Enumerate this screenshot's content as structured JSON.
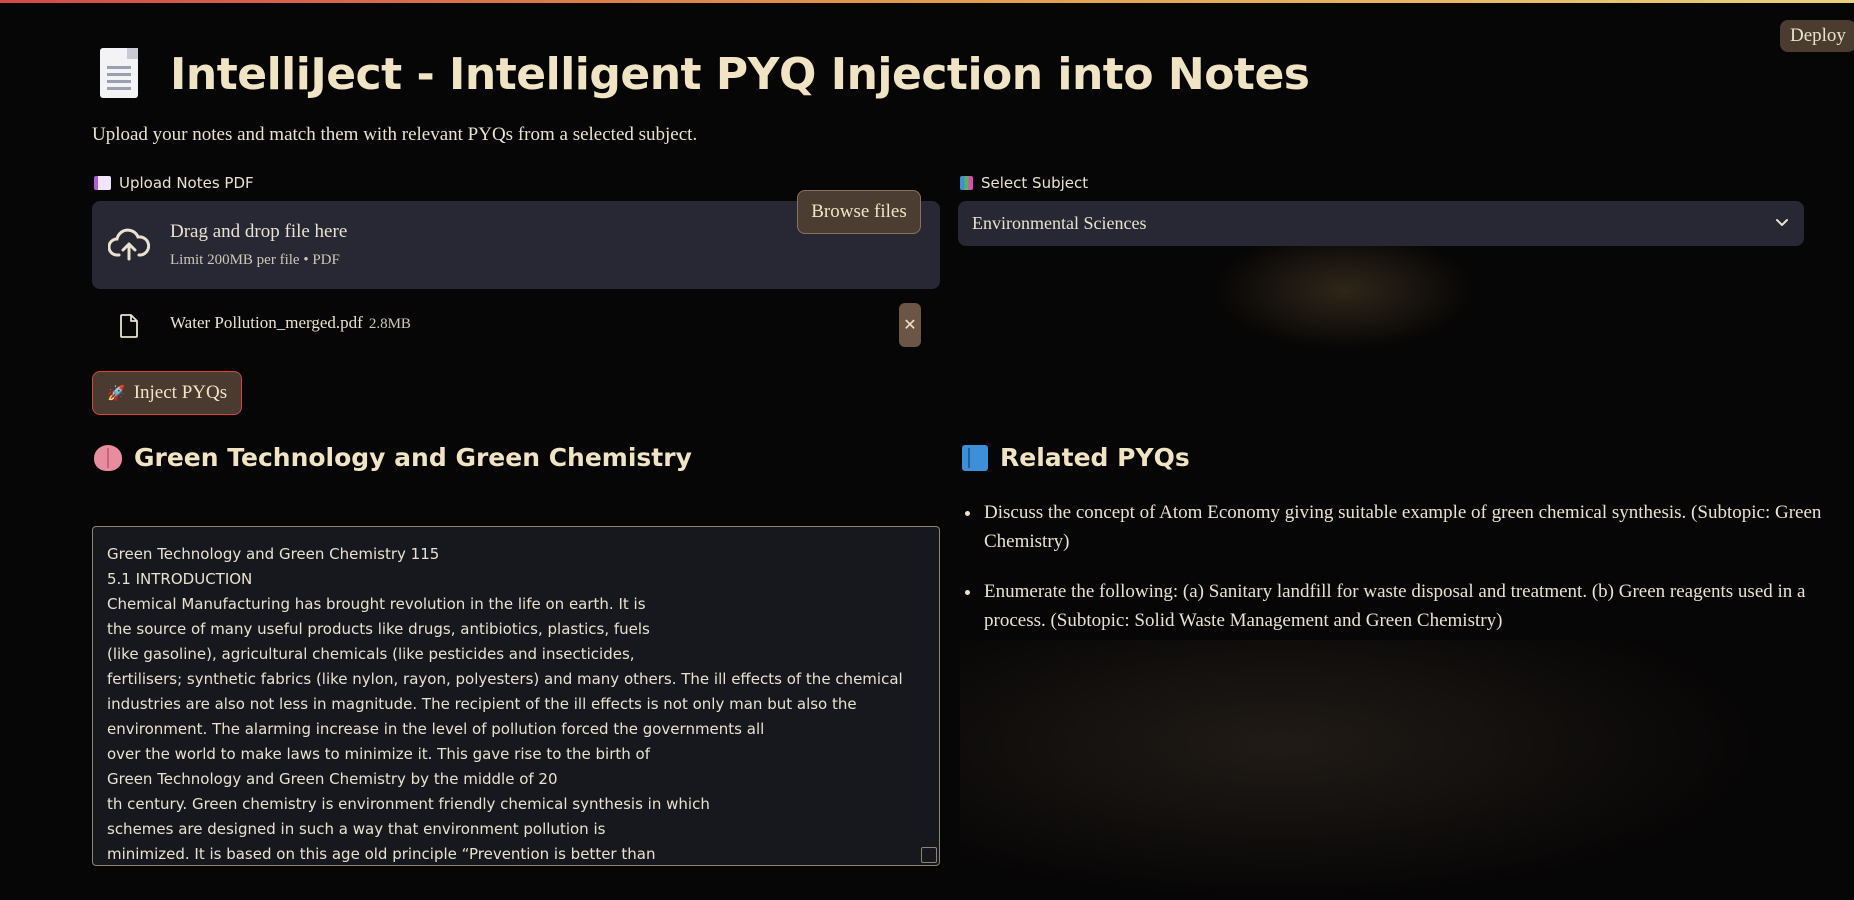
{
  "toolbar": {
    "deploy_label": "Deploy"
  },
  "header": {
    "title": "IntelliJect - Intelligent PYQ Injection into Notes",
    "subtitle": "Upload your notes and match them with relevant PYQs from a selected subject."
  },
  "upload": {
    "label": "Upload Notes PDF",
    "drag_text": "Drag and drop file here",
    "limit_text": "Limit 200MB per file • PDF",
    "browse_label": "Browse files",
    "file_name": "Water Pollution_merged.pdf",
    "file_size": "2.8MB"
  },
  "subject": {
    "label": "Select Subject",
    "selected": "Environmental Sciences"
  },
  "inject_button": "Inject PYQs",
  "notes": {
    "heading": "Green Technology and Green Chemistry",
    "lines": [
      "Green Technology and Green Chemistry 115",
      "5.1 INTRODUCTION",
      "Chemical Manufacturing has brought revolution in the life on earth. It is",
      "the source of many useful products like drugs, antibiotics, plastics, fuels",
      "(like gasoline), agricultural chemicals (like pesticides and insecticides,",
      "fertilisers; synthetic fabrics (like nylon, rayon, polyesters) and many others. The ill effects of the chemical",
      "industries are also not less in magnitude. The recipient of the ill effects is not only man but also the",
      "environment. The alarming increase in the level of pollution forced the governments all",
      "over the world to make laws to minimize it. This gave rise to the birth of",
      "Green Technology and Green Chemistry by the middle of 20",
      "th century. Green chemistry is environment friendly chemical synthesis in which",
      "schemes are designed in such a way that environment pollution is",
      "minimized. It is based on this age old principle “Prevention is better than"
    ]
  },
  "pyqs": {
    "heading": "Related PYQs",
    "items": [
      "Discuss the concept of Atom Economy giving suitable example of green chemical synthesis. (Subtopic: Green Chemistry)",
      "Enumerate the following: (a) Sanitary landfill for waste disposal and treatment. (b) Green reagents used in a process. (Subtopic: Solid Waste Management and Green Chemistry)"
    ]
  },
  "colors": {
    "accent": "#d4463e",
    "title": "#f1e4c4",
    "panel": "#272833"
  },
  "icons": [
    "document-icon",
    "cloud-upload-icon",
    "file-icon",
    "close-icon",
    "rocket-icon",
    "brain-icon",
    "book-icon",
    "books-icon",
    "chevron-down-icon"
  ]
}
